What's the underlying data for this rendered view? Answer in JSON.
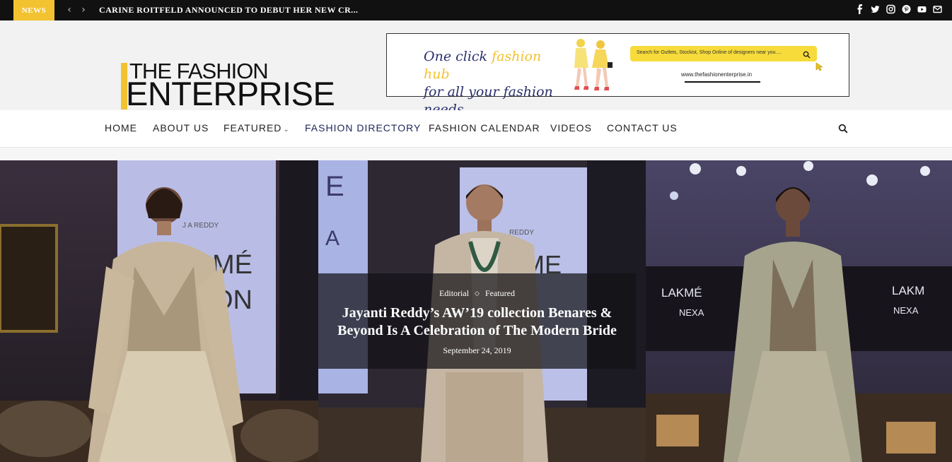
{
  "topbar": {
    "badge": "NEWS",
    "prev_icon": "chevron-left-icon",
    "next_icon": "chevron-right-icon",
    "ticker": "CARINE ROITFELD ANNOUNCED TO DEBUT HER NEW CR...",
    "social": [
      "facebook-icon",
      "twitter-icon",
      "instagram-icon",
      "pinterest-icon",
      "youtube-icon",
      "email-icon"
    ]
  },
  "logo": {
    "line1": "THE FASHION",
    "line2": "ENTERPRISE",
    "accent": "#f2c230"
  },
  "ad": {
    "tagline_a": "One click ",
    "tagline_b": "fashion hub",
    "tagline_c": "for all your fashion needs.",
    "search_placeholder": "Search for Outlets, Stockist, Shop Online of designers near you....",
    "url": "www.thefashionenterprise.in"
  },
  "nav": {
    "items": [
      "HOME",
      "ABOUT US",
      "FEATURED",
      "FASHION DIRECTORY",
      "FASHION CALENDAR",
      "VIDEOS",
      "CONTACT US"
    ],
    "active": "FASHION DIRECTORY",
    "featured_caret": "⌄",
    "search_icon": "search-icon"
  },
  "hero": {
    "categories": [
      "Editorial",
      "Featured"
    ],
    "separator": "◇",
    "headline_line1": "Jayanti Reddy’s AW’19 collection Benares &",
    "headline_line2": "Beyond Is A Celebration of The Modern Bride",
    "date": "September 24, 2019"
  }
}
